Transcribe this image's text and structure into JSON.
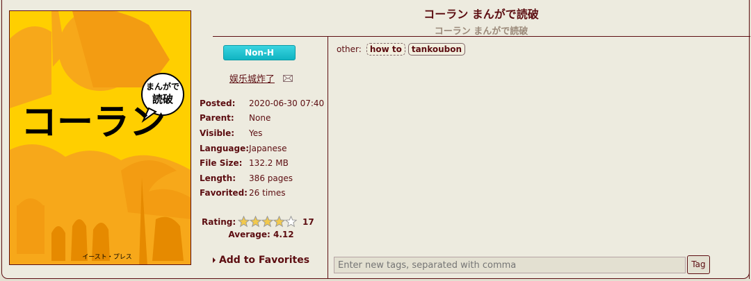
{
  "gallery": {
    "title_en": "コーラン まんがで読破",
    "title_jp": "コーラン まんがで読破",
    "cover_alt": "コーラン まんがで読破 cover",
    "cover_text": {
      "badge_line1": "まんがで",
      "badge_line2": "読破",
      "title": "コーラン",
      "publisher": "イースト・プレス"
    },
    "category": "Non-H",
    "uploader": "娱乐城炸了",
    "meta": [
      {
        "key": "Posted:",
        "value": "2020-06-30 07:40"
      },
      {
        "key": "Parent:",
        "value": "None"
      },
      {
        "key": "Visible:",
        "value": "Yes"
      },
      {
        "key": "Language:",
        "value": "Japanese"
      },
      {
        "key": "File Size:",
        "value": "132.2 MB"
      },
      {
        "key": "Length:",
        "value": "386 pages"
      },
      {
        "key": "Favorited:",
        "value": "26 times"
      }
    ],
    "rating": {
      "label": "Rating:",
      "count": "17",
      "average": "Average: 4.12",
      "stars_filled": 4,
      "stars_total": 5
    },
    "favorites_label": "Add to Favorites",
    "tags": {
      "namespace": "other:",
      "items": [
        "how to",
        "tankoubon"
      ]
    },
    "new_tag": {
      "placeholder": "Enter new tags, separated with comma",
      "button": "Tag"
    }
  },
  "colors": {
    "accent": "#5c0d11",
    "category_cyan": "#10b4c2",
    "cover_yellow": "#ffcf00"
  }
}
